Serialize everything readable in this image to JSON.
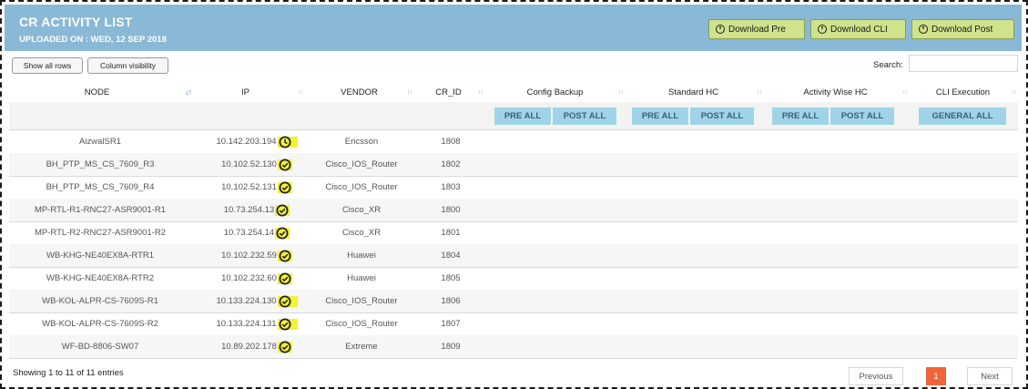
{
  "header": {
    "title": "CR ACTIVITY LIST",
    "uploaded": "UPLOADED ON : WED, 12 SEP 2018",
    "buttons": [
      {
        "label": "Download Pre",
        "icon": "download-circle-icon"
      },
      {
        "label": "Download CLI",
        "icon": "download-circle-icon"
      },
      {
        "label": "Download Post",
        "icon": "download-circle-icon"
      }
    ]
  },
  "toolbar": {
    "show_all_rows": "Show all rows",
    "column_visibility": "Column visibility",
    "search_label": "Search:",
    "search_value": ""
  },
  "columns": {
    "node": "NODE",
    "ip": "IP",
    "vendor": "VENDOR",
    "cr_id": "CR_ID",
    "config_backup": "Config Backup",
    "standard_hc": "Standard HC",
    "activity_hc": "Activity Wise HC",
    "cli_execution": "CLI Execution"
  },
  "actions": {
    "config_pre": "PRE ALL",
    "config_post": "POST ALL",
    "std_pre": "PRE ALL",
    "std_post": "POST ALL",
    "act_pre": "PRE ALL",
    "act_post": "POST ALL",
    "general": "GENERAL ALL"
  },
  "rows": [
    {
      "node": "AizwalSR1",
      "ip": "10.142.203.194",
      "vendor": "Ericsson",
      "cr_id": "1808",
      "status": "pending"
    },
    {
      "node": "BH_PTP_MS_CS_7609_R3",
      "ip": "10.102.52.130",
      "vendor": "Cisco_IOS_Router",
      "cr_id": "1802",
      "status": "ok"
    },
    {
      "node": "BH_PTP_MS_CS_7609_R4",
      "ip": "10.102.52.131",
      "vendor": "Cisco_IOS_Router",
      "cr_id": "1803",
      "status": "ok"
    },
    {
      "node": "MP-RTL-R1-RNC27-ASR9001-R1",
      "ip": "10.73.254.13",
      "vendor": "Cisco_XR",
      "cr_id": "1800",
      "status": "ok"
    },
    {
      "node": "MP-RTL-R2-RNC27-ASR9001-R2",
      "ip": "10.73.254.14",
      "vendor": "Cisco_XR",
      "cr_id": "1801",
      "status": "ok"
    },
    {
      "node": "WB-KHG-NE40EX8A-RTR1",
      "ip": "10.102.232.59",
      "vendor": "Huawei",
      "cr_id": "1804",
      "status": "ok"
    },
    {
      "node": "WB-KHG-NE40EX8A-RTR2",
      "ip": "10.102.232.60",
      "vendor": "Huawei",
      "cr_id": "1805",
      "status": "ok"
    },
    {
      "node": "WB-KOL-ALPR-CS-7609S-R1",
      "ip": "10.133.224.130",
      "vendor": "Cisco_IOS_Router",
      "cr_id": "1806",
      "status": "ok"
    },
    {
      "node": "WB-KOL-ALPR-CS-7609S-R2",
      "ip": "10.133.224.131",
      "vendor": "Cisco_IOS_Router",
      "cr_id": "1807",
      "status": "ok"
    },
    {
      "node": "WF-BD-8806-SW07",
      "ip": "10.89.202.178",
      "vendor": "Extreme",
      "cr_id": "1809",
      "status": "ok"
    }
  ],
  "footer": {
    "info": "Showing 1 to 11 of 11 entries",
    "previous": "Previous",
    "page": "1",
    "next": "Next"
  },
  "colors": {
    "header_bg": "#89b9d6",
    "download_btn": "#cfe28c",
    "action_btn": "#9fd4e6",
    "highlight": "#f3f13a",
    "pager_current": "#f2643a"
  }
}
